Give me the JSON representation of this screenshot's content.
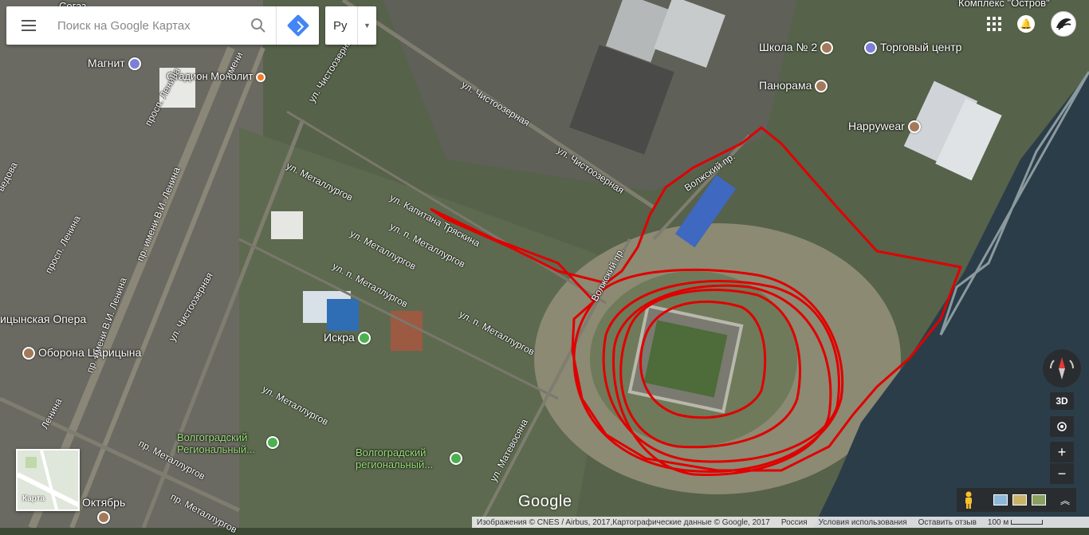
{
  "search": {
    "placeholder": "Поиск на Google Картах"
  },
  "language": {
    "label": "Ру"
  },
  "labels": {
    "sogaz": "Согаз",
    "magnit": "Магнит",
    "stadium": "Стадион Монолит",
    "school": "Школа № 2",
    "mall": "Торговый центр",
    "panorama": "Панорама",
    "happywear": "Happywear",
    "complex": "Комплекс \"Остров\"",
    "opera": "ицынская Опера",
    "oborona": "Оборона Царицына",
    "iskra": "Искра",
    "park1": "Волгоградский Региональный...",
    "park2": "Волгоградский региональный...",
    "oktyabr": "Октябрь"
  },
  "streets": {
    "s1": "ул. Чистоозерная",
    "s2": "ул. Чистоозерная",
    "s3": "ул. Чистоозерная",
    "s4": "ул. Капитана Тряскина",
    "s5": "ул. Металлургов",
    "s6": "ул. п. Металлургов",
    "s7": "ул. п. Металлургов",
    "s8": "ул. п. Металлургов",
    "s9": "Волжский пр.",
    "s10": "Волжский пр.",
    "s11": "пр. имени В.И. Ленина",
    "s12": "пр. имени В.И. Ленина",
    "s13": "просп. Ленина",
    "s14": "просп. Ленина",
    "s15": "ул. Матевосяна",
    "s16": "пр. Металлургов",
    "s17": "пр. Металлургов",
    "s18": "ул. Металлургов",
    "s19": "ул. Чистоозерная",
    "s20": "ул. Металлургов",
    "s21": "Ленина",
    "s22": "имени",
    "s23": "ведова"
  },
  "minimap": {
    "label": "Карта"
  },
  "logo": "Google",
  "footer": {
    "imagery": "Изображения © CNES / Airbus, 2017,Картографические данные © Google, 2017",
    "country": "Россия",
    "terms": "Условия использования",
    "feedback": "Оставить отзыв",
    "scale": "100 м"
  },
  "controls": {
    "btn3d": "3D",
    "zoom_in": "+",
    "zoom_out": "−"
  },
  "colors": {
    "track": "#e00000",
    "accent": "#4285f4"
  }
}
